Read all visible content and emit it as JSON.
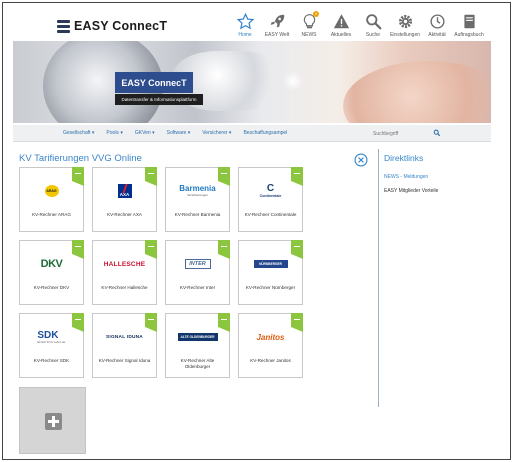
{
  "brand": {
    "name": "EASY ConnecT"
  },
  "nav": [
    {
      "label": "Home",
      "icon": "star-icon",
      "active": true
    },
    {
      "label": "EASY Welt",
      "icon": "rocket-icon"
    },
    {
      "label": "NEWS",
      "icon": "lightbulb-icon",
      "badge": "0"
    },
    {
      "label": "Aktuelles",
      "icon": "warning-icon"
    },
    {
      "label": "Suche",
      "icon": "search-icon"
    },
    {
      "label": "Einstellungen",
      "icon": "gear-icon"
    },
    {
      "label": "Aktivität",
      "icon": "clock-icon"
    },
    {
      "label": "Auftragsbuch",
      "icon": "book-icon"
    }
  ],
  "hero": {
    "title": "EASY ConnecT",
    "subtitle": "Datentransfer & Informationsplattform"
  },
  "menu": [
    {
      "label": "Gesellschaft"
    },
    {
      "label": "Pools"
    },
    {
      "label": "GKVen"
    },
    {
      "label": "Software"
    },
    {
      "label": "Versicherer"
    },
    {
      "label": "Beschaffungsampel"
    }
  ],
  "search": {
    "placeholder": "Suchbegriff"
  },
  "main": {
    "title": "KV Tarifierungen VVG Online",
    "tiles": [
      {
        "label": "KV-Rechner ARAG",
        "logo_text": "ARAG"
      },
      {
        "label": "KV-Rechner AXA",
        "logo_text": "AXA"
      },
      {
        "label": "KV-Rechner Barmenia",
        "logo_text": "Barmenia",
        "logo_sub": "Versicherungen"
      },
      {
        "label": "KV-Rechner Continentale",
        "logo_text": "C",
        "logo_sub": "Continentale"
      },
      {
        "label": "KV-Rechner DKV",
        "logo_text": "DKV"
      },
      {
        "label": "KV-Rechner Hallesche",
        "logo_text": "HALLESCHE"
      },
      {
        "label": "KV-Rechner Inter",
        "logo_text": "INTER"
      },
      {
        "label": "KV-Rechner Nürnberger",
        "logo_text": "NÜRNBERGER"
      },
      {
        "label": "KV-Rechner SDK",
        "logo_text": "SDK",
        "logo_sub": "Einfach für ihr Leben da."
      },
      {
        "label": "KV-Rechner Signal Iduna",
        "logo_text": "SIGNAL IDUNA"
      },
      {
        "label": "KV-Rechner Alte Oldenburger",
        "logo_text": "ALTE OLDENBURGER"
      },
      {
        "label": "KV-Rechner Janitos",
        "logo_text": "Janitos"
      }
    ]
  },
  "sidebar": {
    "title": "Direktlinks",
    "links": [
      {
        "label": "NEWS - Meldungen"
      },
      {
        "label": "EASY Mitglieder Vorteile"
      }
    ]
  },
  "colors": {
    "accent": "#3a86c8",
    "tile_corner": "#8cc63f",
    "hero_box": "#2d4d8f"
  }
}
